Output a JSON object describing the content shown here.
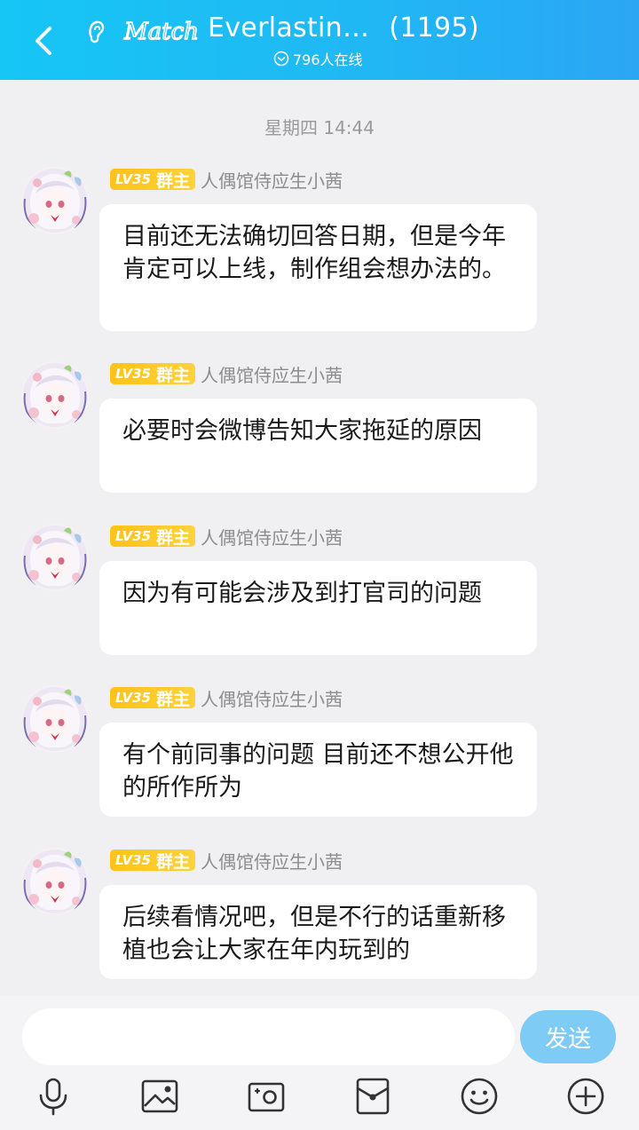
{
  "header": {
    "logo_text": "Match",
    "title": "Everlastin…",
    "member_count": "(1195)",
    "online": "796人在线"
  },
  "timestamp": "星期四 14:44",
  "messages": [
    {
      "level": "LV35",
      "role": "群主",
      "sender": "人偶馆侍应生小茜",
      "text": "目前还无法确切回答日期，但是今年肯定可以上线，制作组会想办法的。"
    },
    {
      "level": "LV35",
      "role": "群主",
      "sender": "人偶馆侍应生小茜",
      "text": "必要时会微博告知大家拖延的原因"
    },
    {
      "level": "LV35",
      "role": "群主",
      "sender": "人偶馆侍应生小茜",
      "text": "因为有可能会涉及到打官司的问题"
    },
    {
      "level": "LV35",
      "role": "群主",
      "sender": "人偶馆侍应生小茜",
      "text": "有个前同事的问题 目前还不想公开他的所作所为"
    },
    {
      "level": "LV35",
      "role": "群主",
      "sender": "人偶馆侍应生小茜",
      "text": "后续看情况吧，但是不行的话重新移植也会让大家在年内玩到的"
    }
  ],
  "input": {
    "value": "",
    "placeholder": ""
  },
  "send_label": "发送",
  "toolbar": [
    "microphone-icon",
    "image-icon",
    "camera-icon",
    "red-packet-icon",
    "emoji-icon",
    "plus-icon"
  ],
  "colors": {
    "header_start": "#16c6f5",
    "header_end": "#2ba6f3",
    "send_button": "#7ecbf5",
    "badge": "#ffc21a"
  }
}
